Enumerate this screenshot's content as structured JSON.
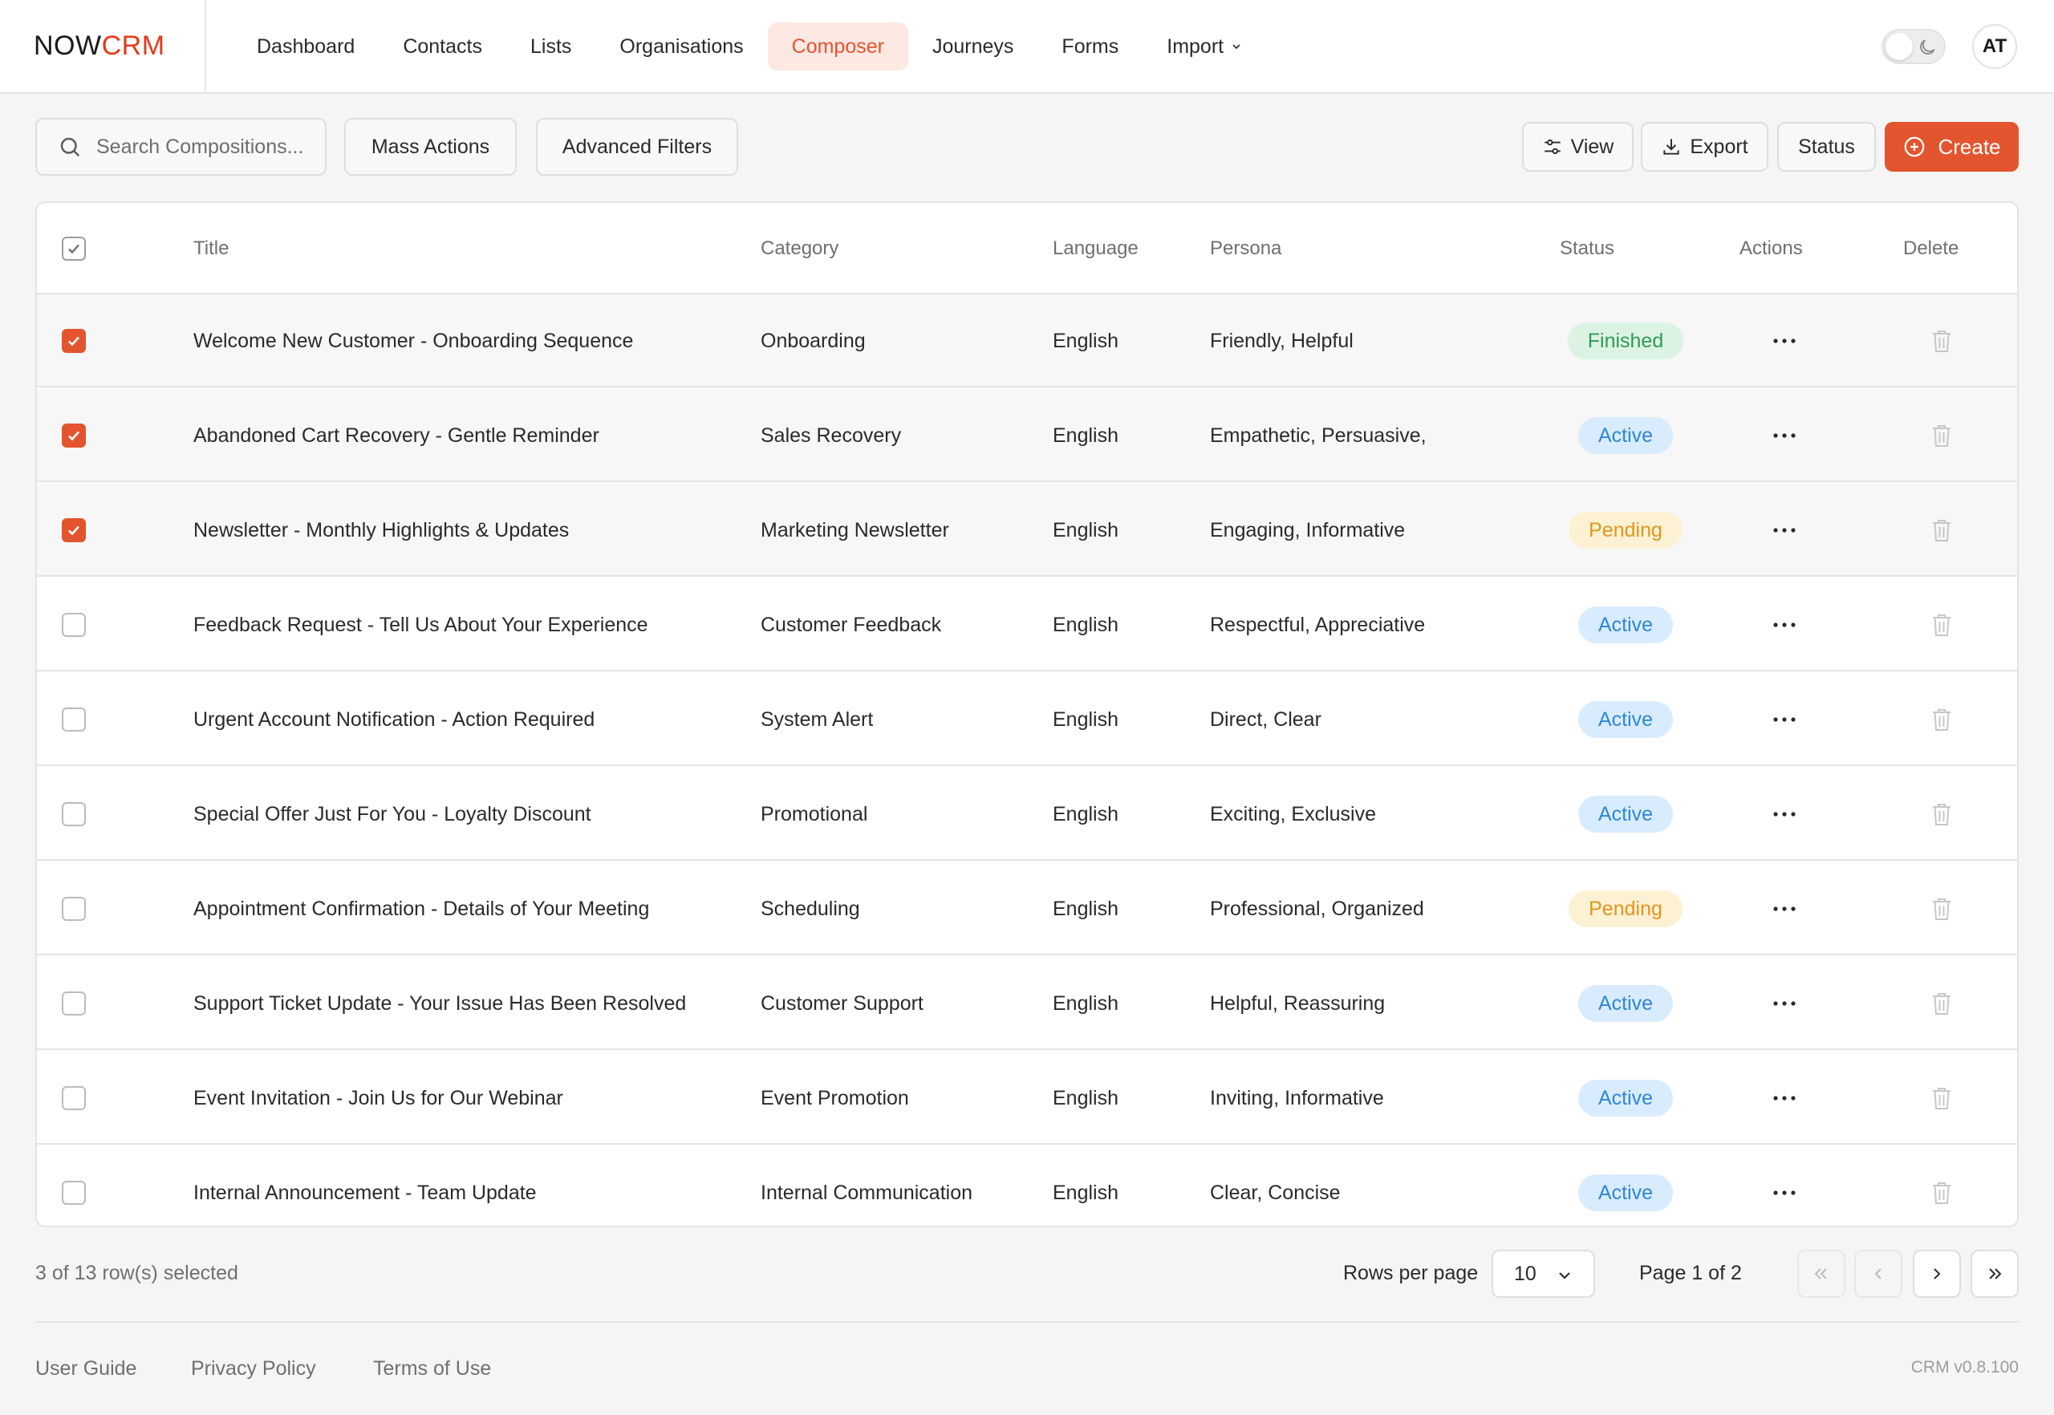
{
  "brand": {
    "now": "NOW",
    "crm": "CRM"
  },
  "nav": {
    "items": [
      {
        "label": "Dashboard"
      },
      {
        "label": "Contacts"
      },
      {
        "label": "Lists"
      },
      {
        "label": "Organisations"
      },
      {
        "label": "Composer",
        "active": true
      },
      {
        "label": "Journeys"
      },
      {
        "label": "Forms"
      },
      {
        "label": "Import",
        "dropdown": true
      }
    ]
  },
  "user": {
    "initials": "AT"
  },
  "toolbar": {
    "search_placeholder": "Search Compositions...",
    "mass_actions": "Mass Actions",
    "advanced_filters": "Advanced Filters",
    "view": "View",
    "export": "Export",
    "status": "Status",
    "create": "Create"
  },
  "table": {
    "headers": {
      "title": "Title",
      "category": "Category",
      "language": "Language",
      "persona": "Persona",
      "status": "Status",
      "actions": "Actions",
      "delete": "Delete"
    },
    "rows": [
      {
        "checked": true,
        "title": "Welcome New Customer - Onboarding Sequence",
        "category": "Onboarding",
        "language": "English",
        "persona": "Friendly, Helpful",
        "status": "Finished"
      },
      {
        "checked": true,
        "title": "Abandoned Cart Recovery - Gentle Reminder",
        "category": "Sales Recovery",
        "language": "English",
        "persona": "Empathetic, Persuasive,",
        "status": "Active"
      },
      {
        "checked": true,
        "title": "Newsletter - Monthly Highlights & Updates",
        "category": "Marketing Newsletter",
        "language": "English",
        "persona": "Engaging, Informative",
        "status": "Pending"
      },
      {
        "checked": false,
        "title": "Feedback Request - Tell Us About Your Experience",
        "category": "Customer Feedback",
        "language": "English",
        "persona": "Respectful, Appreciative",
        "status": "Active"
      },
      {
        "checked": false,
        "title": "Urgent Account Notification - Action Required",
        "category": "System Alert",
        "language": "English",
        "persona": "Direct, Clear",
        "status": "Active"
      },
      {
        "checked": false,
        "title": "Special Offer Just For You - Loyalty Discount",
        "category": "Promotional",
        "language": "English",
        "persona": "Exciting, Exclusive",
        "status": "Active"
      },
      {
        "checked": false,
        "title": "Appointment Confirmation - Details of Your Meeting",
        "category": "Scheduling",
        "language": "English",
        "persona": "Professional, Organized",
        "status": "Pending"
      },
      {
        "checked": false,
        "title": "Support Ticket Update - Your Issue Has Been Resolved",
        "category": "Customer Support",
        "language": "English",
        "persona": "Helpful, Reassuring",
        "status": "Active"
      },
      {
        "checked": false,
        "title": "Event Invitation - Join Us for Our Webinar",
        "category": "Event Promotion",
        "language": "English",
        "persona": "Inviting, Informative",
        "status": "Active"
      },
      {
        "checked": false,
        "title": "Internal Announcement - Team Update",
        "category": "Internal Communication",
        "language": "English",
        "persona": "Clear, Concise",
        "status": "Active"
      }
    ]
  },
  "status_colors": {
    "Finished": {
      "bg": "#dcf3e3",
      "fg": "#2f9a55"
    },
    "Active": {
      "bg": "#d9ecfd",
      "fg": "#2f86d6"
    },
    "Pending": {
      "bg": "#fdf1d4",
      "fg": "#e0961c"
    }
  },
  "footer": {
    "selected_text": "3 of 13  row(s) selected",
    "rows_per_page_label": "Rows per page",
    "rows_per_page_value": "10",
    "page_text": "Page 1  of  2",
    "links": [
      "User Guide",
      "Privacy Policy",
      "Terms of Use"
    ],
    "version": "CRM v0.8.100"
  },
  "colors": {
    "accent": "#e2552f"
  }
}
